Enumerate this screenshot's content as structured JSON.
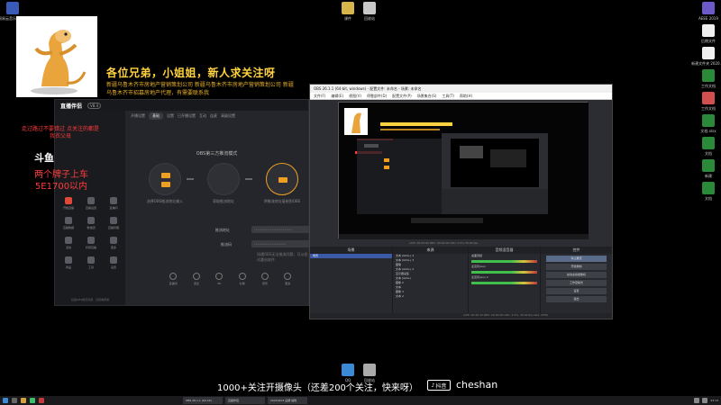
{
  "desktop": {
    "icons_top": [
      {
        "label": "网易云音乐播放器",
        "color": "#3a5ab8"
      },
      {
        "label": "课件",
        "color": "#d6b54a"
      },
      {
        "label": "回收站",
        "color": "#c8c8c8"
      }
    ],
    "icons_right": [
      {
        "label": "AEEE 2019",
        "color": "#6b5ac8"
      },
      {
        "label": "后期文件",
        "color": "#f0f0f0"
      },
      {
        "label": "新建文件夹 2020.12",
        "color": "#f0f0f0"
      },
      {
        "label": "工作文档",
        "color": "#2a8a3a"
      },
      {
        "label": "工作文档",
        "color": "#d05050"
      },
      {
        "label": "文档.xlsx",
        "color": "#2a8a3a"
      },
      {
        "label": "文档",
        "color": "#2a8a3a"
      },
      {
        "label": "新建",
        "color": "#2a8a3a"
      },
      {
        "label": "文档",
        "color": "#2a8a3a"
      }
    ],
    "icons_bottom": [
      {
        "label": "QQ",
        "color": "#3a8ad8"
      },
      {
        "label": "回收站",
        "color": "#aaaaaa"
      }
    ]
  },
  "overlay": {
    "headline": "各位兄弟，小姐姐，新人求关注呀",
    "subline": "新疆乌鲁木齐市房地产营销策划公司  新疆乌鲁木齐市房地产营销策划公司  新疆乌鲁木齐市招募房地产代理，有需要联系我",
    "red_note": "走过路过不要错过 点关注的都是我衣父母",
    "douyu": "斗鱼",
    "plate": "两个牌子上车 5E1700以内",
    "bottom_text": "1000+关注开摄像头（还差200个关注，快来呀）",
    "tiktok_label": "抖音",
    "tiktok_name": "cheshan"
  },
  "streamer_app": {
    "logo": "直播伴侣",
    "version": "V8.4",
    "tabs": [
      "开播设置",
      "基础",
      "设置",
      "已开播设置",
      "互动",
      "连麦",
      "高级设置"
    ],
    "mode_title": "OBS第三方推流模式",
    "flow_captions": [
      "选择OBS推流地址输入",
      "获取推流地址",
      "将推流地址复制到OBS"
    ],
    "field1_label": "推流地址",
    "field1_value": "••••••••••••••••••••••••",
    "field2_label": "推流码",
    "field2_value": "••••••••••••••••••••",
    "help": "如遇OBS无法推流问题，可以尝试重启软件",
    "tools": [
      "直播间",
      "连麦",
      "PK",
      "礼物",
      "音乐",
      "更多"
    ],
    "side_items": [
      {
        "label": "开始直播",
        "red": true
      },
      {
        "label": "直播设置",
        "red": false
      },
      {
        "label": "直播间",
        "red": false
      },
      {
        "label": "直播数据",
        "red": false
      },
      {
        "label": "粉丝团",
        "red": false
      },
      {
        "label": "直播管理",
        "red": false
      },
      {
        "label": "活动",
        "red": false
      },
      {
        "label": "抖音直播",
        "red": false
      },
      {
        "label": "更多",
        "red": false
      },
      {
        "label": "商品",
        "red": false
      },
      {
        "label": "工具",
        "red": false
      },
      {
        "label": "设置",
        "red": false
      }
    ],
    "sidebar_note": "如遇OBS推流问题，请查看帮助"
  },
  "obs": {
    "title": "OBS 26.1.1 (64-bit, windows) - 配置文件: 未命名 - 场景: 未命名",
    "menu": [
      "文件(F)",
      "编辑(E)",
      "视图(V)",
      "停靠部件(D)",
      "配置文件(P)",
      "场景集合(S)",
      "工具(T)",
      "帮助(H)"
    ],
    "status": "LIVE: 00:00:00   REC: 00:00:00   CPU: 2.5%  30.00 fps",
    "docks": {
      "scenes_title": "场景",
      "scenes": [
        "场景"
      ],
      "sources_title": "来源",
      "sources": [
        "文本 (GDI+) 4",
        "文本 (GDI+) 3",
        "图像",
        "文本 (GDI+) 2",
        "显示器采集",
        "文本 (GDI+)",
        "图像 2",
        "文本",
        "图像 3",
        "文本 2"
      ],
      "mixer_title": "音频混音器",
      "mixer": [
        "桌面音频",
        "麦克风/Aux",
        "麦克风/Aux 2"
      ],
      "transitions_title": "场景过渡",
      "controls_title": "控件",
      "controls": [
        "停止推流",
        "开始录制",
        "启动虚拟摄像机",
        "工作室模式",
        "设置",
        "退出"
      ]
    },
    "footer": "LIVE: 00:45:15   REC: 00:00:00   CPU: 3.2%, 30.00 fps   kb/s: 2556"
  },
  "taskbar": {
    "tasks": [
      "OBS 26.1.1 (64-bit)",
      "直播伴侣",
      "20210403 后期 编辑"
    ],
    "time": "23:13"
  }
}
